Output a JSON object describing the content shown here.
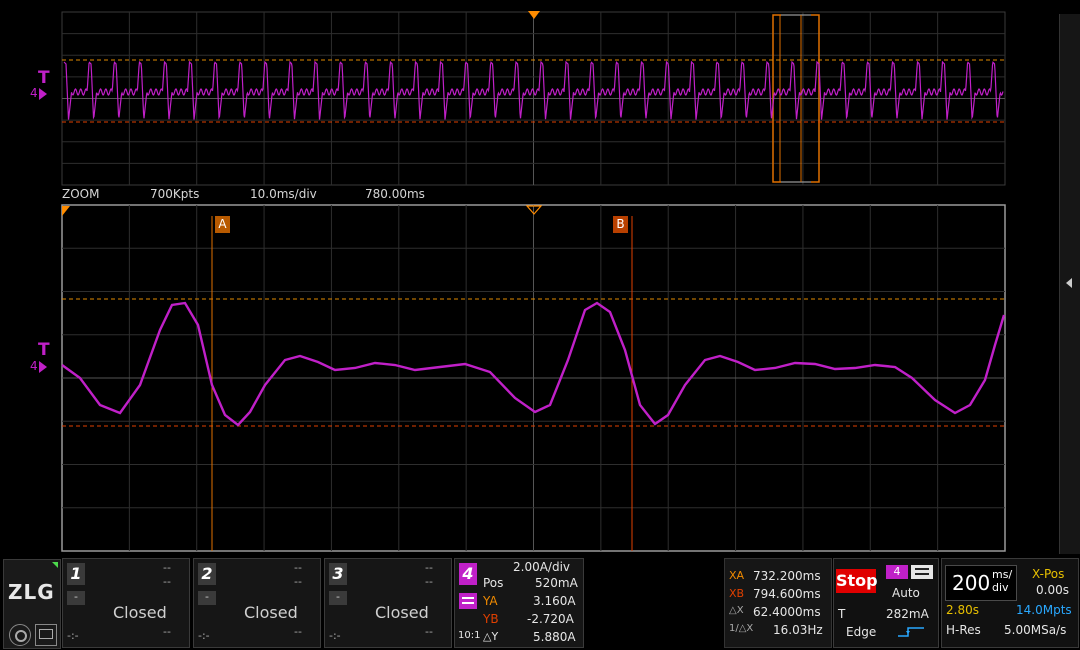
{
  "overview": {
    "trigger_label": "T",
    "channel_marker": "4",
    "zoom_label": "ZOOM",
    "points": "700Kpts",
    "time_per_div": "10.0ms/div",
    "offset": "780.00ms"
  },
  "main": {
    "trigger_label": "T",
    "channel_marker": "4",
    "cursor_a": "A",
    "cursor_b": "B"
  },
  "channels": [
    {
      "num": "1",
      "status": "Closed",
      "top_dash": "--",
      "mid_dash": "--",
      "bottom_left": "-:-",
      "bottom_dash": "--",
      "sign": "-"
    },
    {
      "num": "2",
      "status": "Closed",
      "top_dash": "--",
      "mid_dash": "--",
      "bottom_left": "-:-",
      "bottom_dash": "--",
      "sign": "-"
    },
    {
      "num": "3",
      "status": "Closed",
      "top_dash": "--",
      "mid_dash": "--",
      "bottom_left": "-:-",
      "bottom_dash": "--",
      "sign": "-"
    }
  ],
  "ch4": {
    "num": "4",
    "scale": "2.00A/div",
    "pos_label": "Pos",
    "pos_value": "520mA",
    "ya_label": "YA",
    "ya_value": "3.160A",
    "yb_label": "YB",
    "yb_value": "-2.720A",
    "dy_label": "△Y",
    "dy_value": "5.880A",
    "probe": "10:1"
  },
  "cursors": {
    "xa_label": "XA",
    "xa_value": "732.200ms",
    "xb_label": "XB",
    "xb_value": "794.600ms",
    "dx_label": "△X",
    "dx_value": "62.4000ms",
    "inv_label": "1/△X",
    "inv_value": "16.03Hz"
  },
  "trigger": {
    "run_state": "Stop",
    "mode": "Auto",
    "channel": "4",
    "t_label": "T",
    "level": "282mA",
    "type": "Edge"
  },
  "timebase": {
    "value": "200",
    "unit_top": "ms/",
    "unit_bottom": "div",
    "xpos_label": "X-Pos",
    "xpos_value": "0.00s",
    "window": "2.80s",
    "mem_depth": "14.0Mpts",
    "acq_mode": "H-Res",
    "sample_rate": "5.00MSa/s"
  },
  "brand": {
    "logo": "ZLG"
  },
  "colors": {
    "ch4": "#c020c8",
    "cursor": "#e07000",
    "trigger": "#ff8c00",
    "timebase_yellow": "#e8c000",
    "timebase_blue": "#29a8ff",
    "stop_red": "#e00000"
  }
}
